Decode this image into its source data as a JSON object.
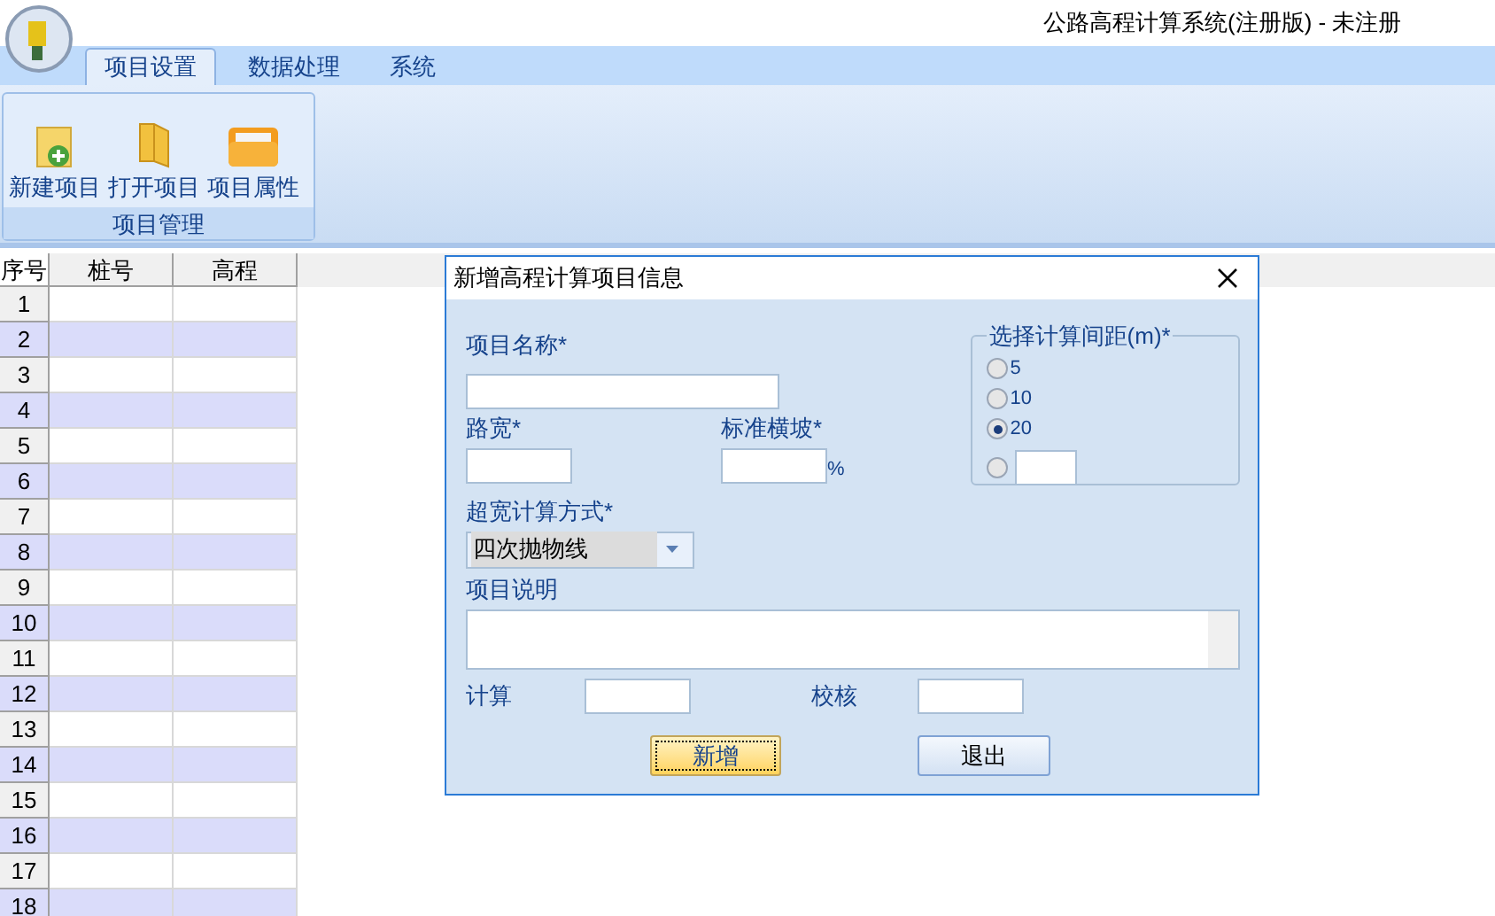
{
  "window": {
    "title": "公路高程计算系统(注册版) - 未注册"
  },
  "menu_tabs": [
    {
      "label": "项目设置",
      "selected": true
    },
    {
      "label": "数据处理",
      "selected": false
    },
    {
      "label": "系统",
      "selected": false
    }
  ],
  "ribbon": {
    "groups": [
      {
        "label": "项目管理",
        "buttons": [
          {
            "label": "新建项目",
            "kind": "new"
          },
          {
            "label": "打开项目",
            "kind": "open"
          },
          {
            "label": "项目属性",
            "kind": "properties"
          }
        ]
      }
    ]
  },
  "grid": {
    "columns": [
      "序号",
      "桩号",
      "高程"
    ],
    "rows": [
      "1",
      "2",
      "3",
      "4",
      "5",
      "6",
      "7",
      "8",
      "9",
      "10",
      "11",
      "12",
      "13",
      "14",
      "15",
      "16",
      "17",
      "18"
    ]
  },
  "dialog": {
    "title": "新增高程计算项目信息",
    "name_label": "项目名称*",
    "road_width_label": "路宽*",
    "cross_slope_label": "标准横坡*",
    "cross_slope_unit": "%",
    "widening_label": "超宽计算方式*",
    "widening_value": "四次抛物线",
    "description_label": "项目说明",
    "calc_label": "计算",
    "check_label": "校核",
    "interval": {
      "legend": "选择计算间距(m)*",
      "options": [
        {
          "kind": "preset",
          "label": "5",
          "selected": false
        },
        {
          "kind": "preset",
          "label": "10",
          "selected": false
        },
        {
          "kind": "preset",
          "label": "20",
          "selected": true
        },
        {
          "kind": "custom",
          "selected": false
        }
      ]
    },
    "buttons": [
      {
        "label": "新增",
        "default": true
      },
      {
        "label": "退出",
        "default": false
      }
    ]
  }
}
